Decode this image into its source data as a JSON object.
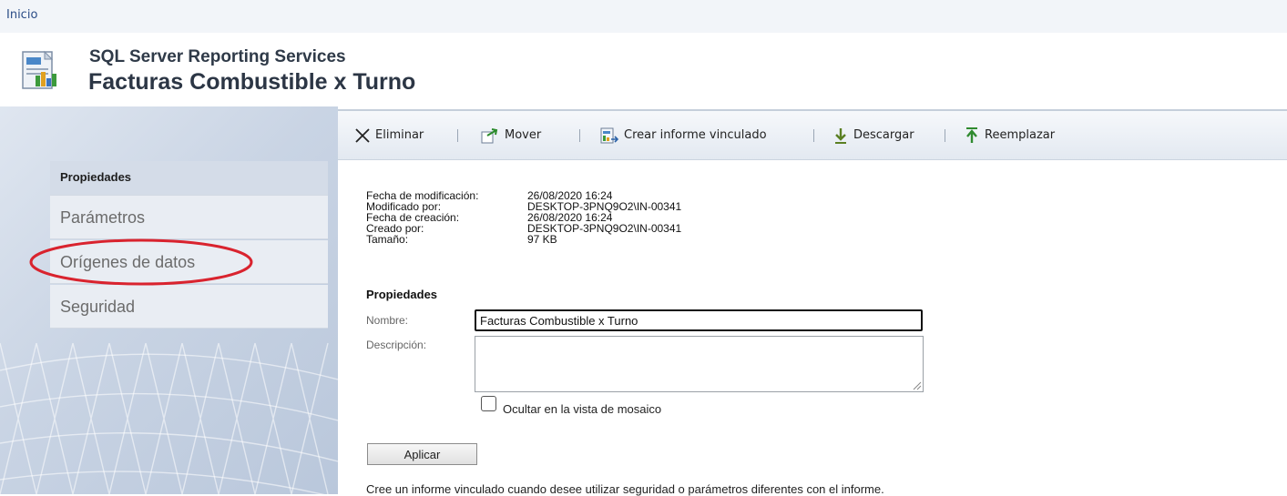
{
  "breadcrumb": {
    "home": "Inicio"
  },
  "header": {
    "subtitle": "SQL Server Reporting Services",
    "title": "Facturas Combustible x Turno"
  },
  "sidebar": {
    "items": [
      {
        "label": "Propiedades",
        "active": true
      },
      {
        "label": "Parámetros"
      },
      {
        "label": "Orígenes de datos",
        "highlighted": true
      },
      {
        "label": "Seguridad"
      }
    ]
  },
  "toolbar": {
    "delete": "Eliminar",
    "move": "Mover",
    "create_linked": "Crear informe vinculado",
    "download": "Descargar",
    "replace": "Reemplazar"
  },
  "details": {
    "modified_date_label": "Fecha de modificación:",
    "modified_date": "26/08/2020 16:24",
    "modified_by_label": "Modificado por:",
    "modified_by": "DESKTOP-3PNQ9O2\\IN-00341",
    "created_date_label": "Fecha de creación:",
    "created_date": "26/08/2020 16:24",
    "created_by_label": "Creado por:",
    "created_by": "DESKTOP-3PNQ9O2\\IN-00341",
    "size_label": "Tamaño:",
    "size": "97 KB"
  },
  "properties": {
    "section_title": "Propiedades",
    "name_label": "Nombre:",
    "name_value": "Facturas Combustible x Turno",
    "description_label": "Descripción:",
    "description_value": "",
    "hide_tile_label": "Ocultar en la vista de mosaico",
    "hide_tile_checked": false,
    "apply_button": "Aplicar"
  },
  "footer_note": "Cree un informe vinculado cuando desee utilizar seguridad o parámetros diferentes con el informe.",
  "colors": {
    "link": "#2a4c86",
    "highlight_oval": "#d9232e",
    "toolbar_bg": "#e3e9f1",
    "sidebar_bg": "#c9d4e4"
  }
}
